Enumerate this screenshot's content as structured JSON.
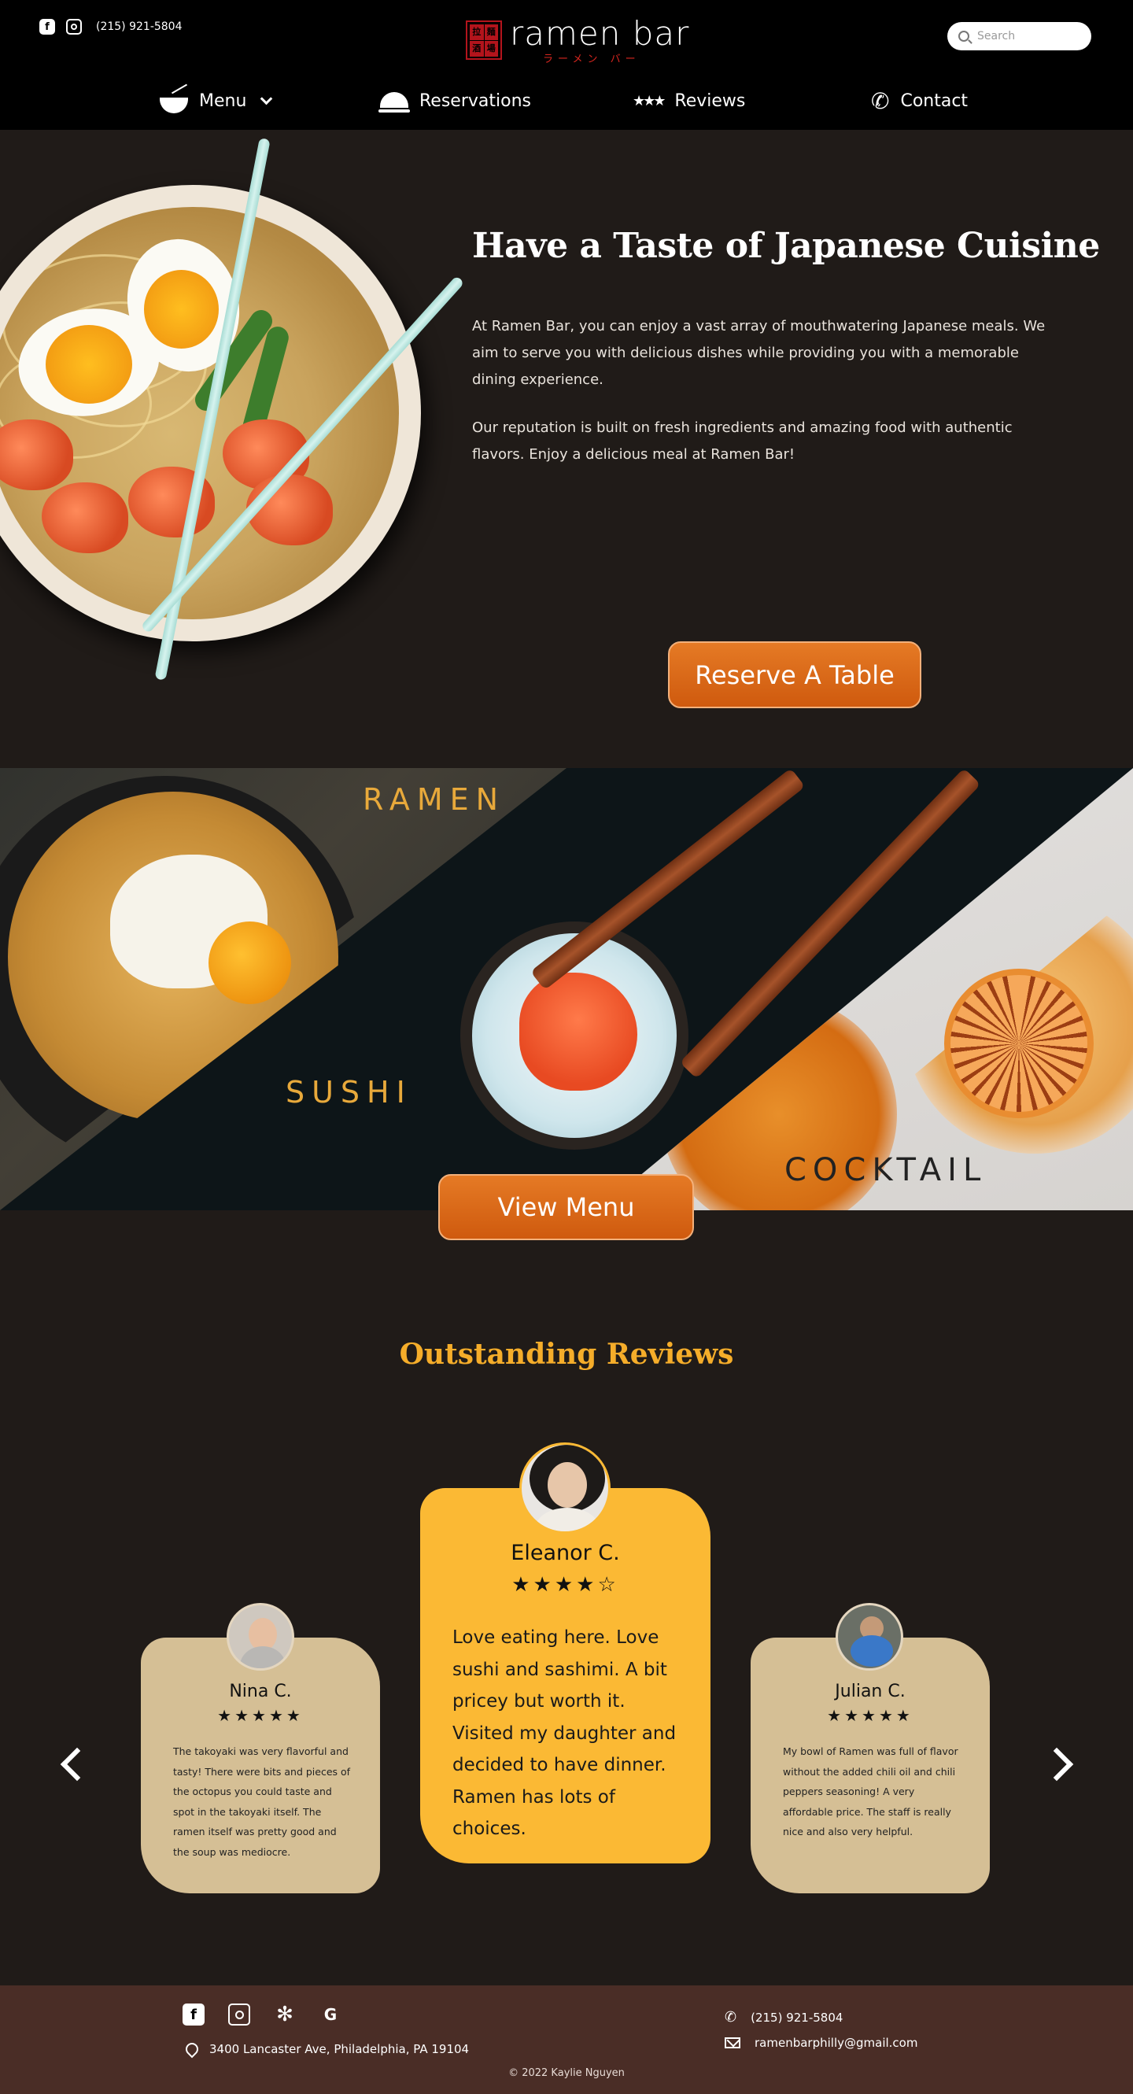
{
  "header": {
    "phone": "(215) 921-5804",
    "social": {
      "facebook_glyph": "f",
      "instagram_icon": "instagram-icon"
    },
    "logo": {
      "name": "ramen bar",
      "subtitle": "ラーメン バー",
      "mark": [
        "拉",
        "麺",
        "酒",
        "場"
      ]
    },
    "search": {
      "placeholder": "Search"
    }
  },
  "nav": {
    "items": [
      {
        "label": "Menu",
        "icon": "bowl-icon"
      },
      {
        "label": "Reservations",
        "icon": "cloche-icon"
      },
      {
        "label": "Reviews",
        "icon": "stars-icon"
      },
      {
        "label": "Contact",
        "icon": "phone-icon"
      }
    ]
  },
  "hero": {
    "title": "Have a Taste of Japanese Cuisine",
    "p1": "At Ramen Bar, you can enjoy a vast array of mouthwatering Japanese meals. We aim to serve you with delicious dishes while providing you with a memorable dining experience.",
    "p2": "Our reputation is built on fresh ingredients and amazing food with authentic flavors. Enjoy a delicious meal at Ramen Bar!",
    "cta": "Reserve A Table"
  },
  "banner": {
    "ramen": "RAMEN",
    "sushi": "SUSHI",
    "cocktail": "COCKTAIL",
    "cta": "View Menu"
  },
  "reviews": {
    "title": "Outstanding Reviews",
    "items": [
      {
        "name": "Nina C.",
        "stars": "★★★★★",
        "rating": 5,
        "text": "The takoyaki was very flavorful and tasty! There were bits and pieces of the octopus you could taste and spot in the takoyaki itself. The ramen itself was pretty good and the soup was mediocre."
      },
      {
        "name": "Eleanor C.",
        "stars": "★★★★☆",
        "rating": 4.5,
        "text": "Love eating here. Love sushi and sashimi. A bit pricey but worth it. Visited my daughter and decided to have dinner. Ramen has lots of choices."
      },
      {
        "name": "Julian C.",
        "stars": "★★★★★",
        "rating": 5,
        "text": "My bowl of Ramen was full of flavor without the added chili oil and chili peppers seasoning! A very affordable price. The staff is really nice and also very helpful."
      }
    ]
  },
  "footer": {
    "address": "3400 Lancaster Ave, Philadelphia, PA 19104",
    "phone": "(215) 921-5804",
    "email": "ramenbarphilly@gmail.com",
    "copyright": "2022 Kaylie Nguyen",
    "social_glyphs": {
      "facebook": "f",
      "yelp": "✻",
      "grubhub": "G"
    }
  },
  "colors": {
    "background": "#201b18",
    "header": "#000000",
    "accent_orange": "#d9661a",
    "accent_gold": "#f5ad2a",
    "card_tan": "#d5bf95",
    "card_gold": "#fbb934",
    "footer": "#4a2d26"
  }
}
